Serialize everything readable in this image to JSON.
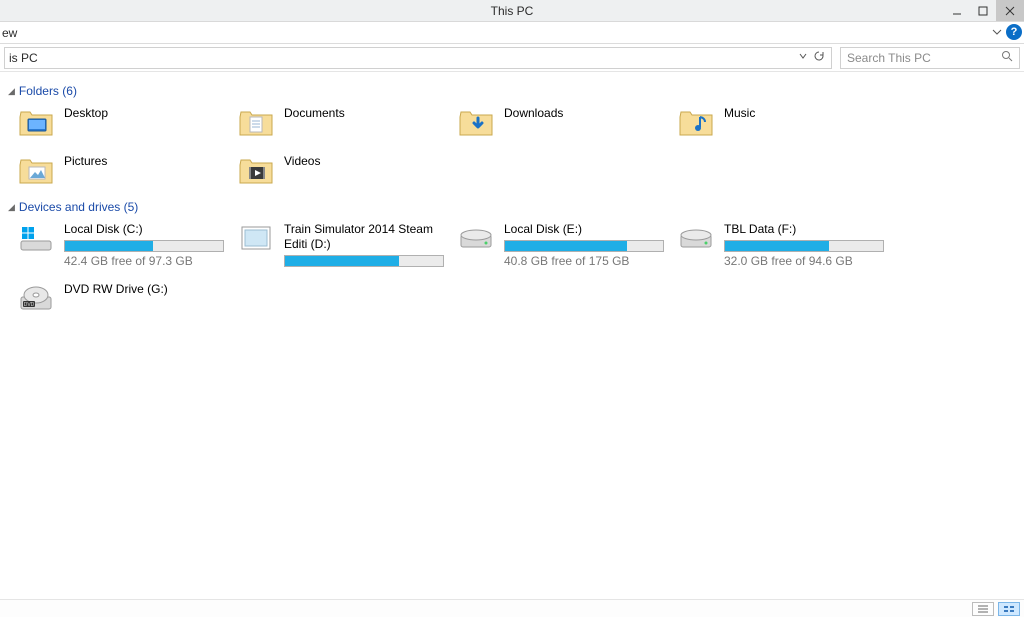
{
  "window": {
    "title": "This PC"
  },
  "ribbon": {
    "tab_fragment": "ew"
  },
  "address": {
    "path_fragment": "is PC"
  },
  "search": {
    "placeholder": "Search This PC"
  },
  "groups": {
    "folders": {
      "header": "Folders (6)",
      "items": [
        {
          "name": "Desktop",
          "icon": "desktop"
        },
        {
          "name": "Documents",
          "icon": "documents"
        },
        {
          "name": "Downloads",
          "icon": "downloads"
        },
        {
          "name": "Music",
          "icon": "music"
        },
        {
          "name": "Pictures",
          "icon": "pictures"
        },
        {
          "name": "Videos",
          "icon": "videos"
        }
      ]
    },
    "drives": {
      "header": "Devices and drives (5)",
      "items": [
        {
          "name": "Local Disk (C:)",
          "sub": "42.4 GB free of 97.3 GB",
          "fill_pct": 56,
          "icon": "winvol"
        },
        {
          "name": "Train Simulator 2014 Steam Editi (D:)",
          "sub": "",
          "fill_pct": 72,
          "icon": "discimg"
        },
        {
          "name": "Local Disk (E:)",
          "sub": "40.8 GB free of 175 GB",
          "fill_pct": 77,
          "icon": "hdd"
        },
        {
          "name": "TBL Data (F:)",
          "sub": "32.0 GB free of 94.6 GB",
          "fill_pct": 66,
          "icon": "hdd"
        },
        {
          "name": "DVD RW Drive (G:)",
          "sub": "",
          "fill_pct": null,
          "icon": "dvd"
        }
      ]
    }
  }
}
